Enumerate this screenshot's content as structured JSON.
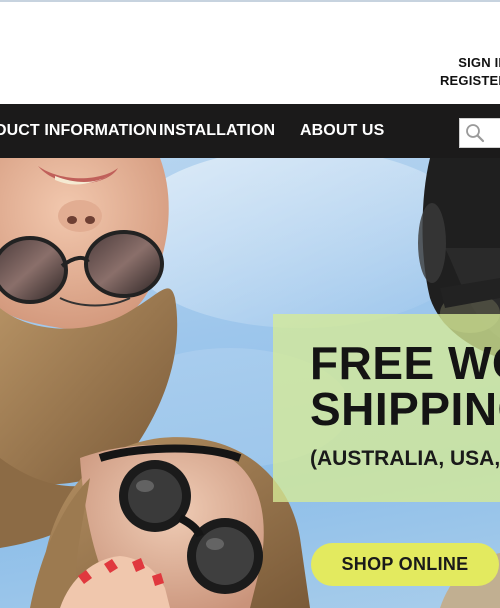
{
  "header": {
    "account_links": [
      "SIGN IN",
      "REGISTER"
    ]
  },
  "nav": {
    "items": [
      "PRODUCT INFORMATION",
      "INSTALLATION",
      "ABOUT US"
    ]
  },
  "search": {
    "placeholder": "",
    "icon": "search-icon"
  },
  "hero": {
    "headline_line1": "FREE WORLDWIDE",
    "headline_line2": "SHIPPING",
    "subline": "(AUSTRALIA, USA, UK)",
    "cta_label": "SHOP ONLINE"
  },
  "colors": {
    "navbar_bg": "#1b1a1a",
    "promo_panel": "#d6eb96",
    "cta_bg": "#e3ea5f",
    "sky": "#9dc6ec"
  }
}
